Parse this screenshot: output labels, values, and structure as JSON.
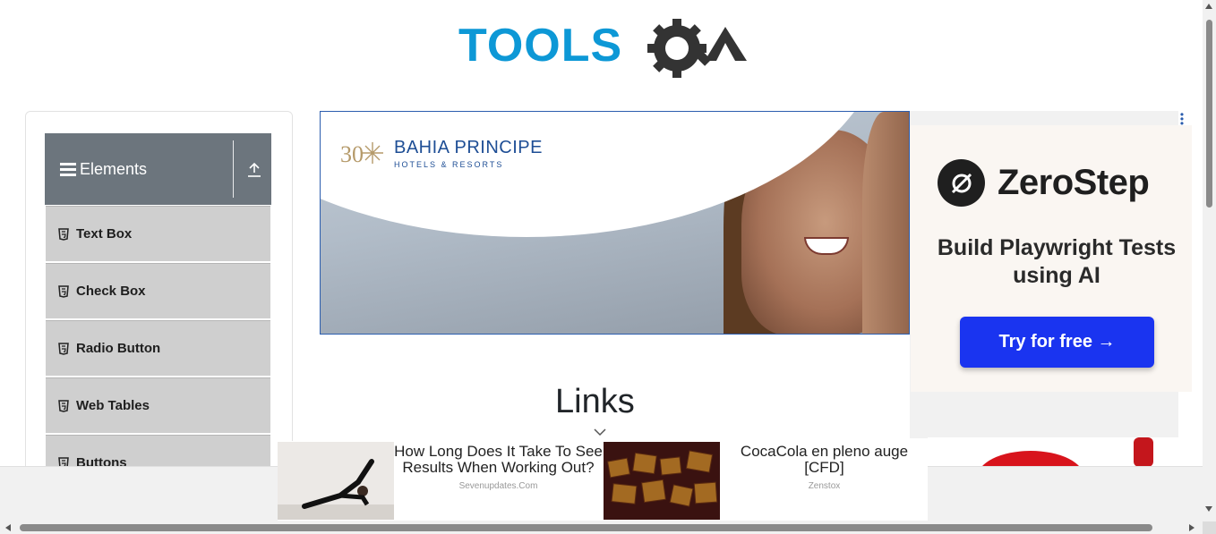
{
  "header": {
    "logo_text": "TOOLSQA"
  },
  "sidebar": {
    "group_title": "Elements",
    "items": [
      {
        "label": "Text Box"
      },
      {
        "label": "Check Box"
      },
      {
        "label": "Radio Button"
      },
      {
        "label": "Web Tables"
      },
      {
        "label": "Buttons"
      }
    ]
  },
  "banner_ad": {
    "brand_name": "BAHIA PRINCIPE",
    "brand_sub": "HOTELS & RESORTS",
    "brand_mark": "30"
  },
  "side_ad": {
    "brand": "ZeroStep",
    "tagline": "Build Playwright Tests using AI",
    "cta": "Try for free →"
  },
  "main": {
    "title": "Links"
  },
  "bottom_ads": [
    {
      "title": "How Long Does It Take To See Results When Working Out?",
      "source": "Sevenupdates.Com"
    },
    {
      "title": "CocaCola en pleno auge [CFD]",
      "source": "Zenstox"
    }
  ],
  "colors": {
    "logo_blue": "#0d98d6",
    "logo_dark": "#333333",
    "sidebar_header": "#6c757d",
    "menu_bg": "#cfcfcf",
    "cta_blue": "#1a34f0"
  }
}
